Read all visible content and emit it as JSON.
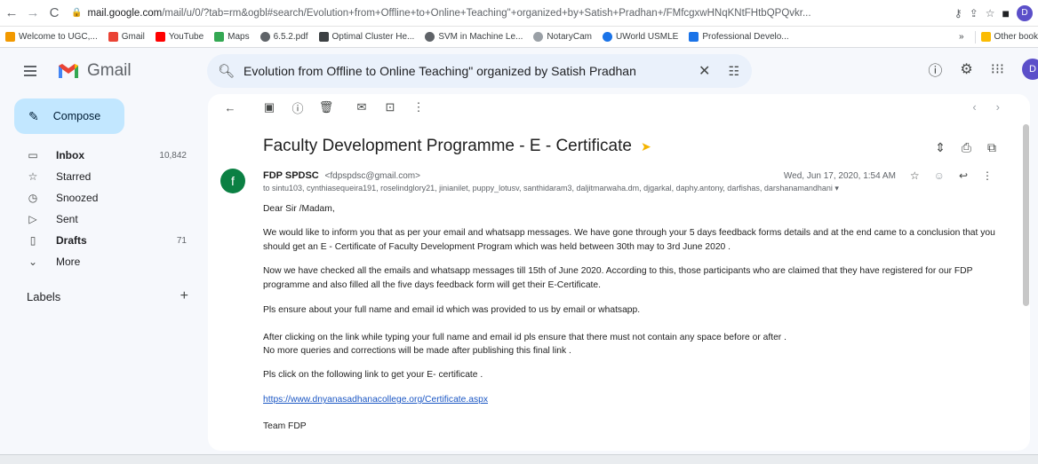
{
  "browser": {
    "url_host": "mail.google.com",
    "url_rest": "/mail/u/0/?tab=rm&ogbl#search/Evolution+from+Offline+to+Online+Teaching\"+organized+by+Satish+Pradhan+/FMfcgxwHNqKNtFHtbQPQvkr...",
    "profile_initial": "D",
    "bookmarks": [
      {
        "label": "Welcome to UGC,...",
        "color": "#f29900"
      },
      {
        "label": "Gmail",
        "color": "#ea4335"
      },
      {
        "label": "YouTube",
        "color": "#ff0000"
      },
      {
        "label": "Maps",
        "color": "#34a853"
      },
      {
        "label": "6.5.2.pdf",
        "color": "#5f6368"
      },
      {
        "label": "Optimal Cluster He...",
        "color": "#3c4043"
      },
      {
        "label": "SVM in Machine Le...",
        "color": "#5f6368"
      },
      {
        "label": "NotaryCam",
        "color": "#9aa0a6"
      },
      {
        "label": "UWorld USMLE",
        "color": "#1a73e8"
      },
      {
        "label": "Professional Develo...",
        "color": "#1a73e8"
      }
    ],
    "bookmarks_more": "»",
    "other_bookmarks": "Other book"
  },
  "gmail": {
    "brand": "Gmail",
    "search_query": "Evolution from Offline to Online Teaching\" organized by Satish Pradhan",
    "avatar_initial": "D"
  },
  "sidebar": {
    "compose_label": "Compose",
    "items": [
      {
        "label": "Inbox",
        "count": "10,842",
        "icon": "inbox-icon",
        "bold": true
      },
      {
        "label": "Starred",
        "count": "",
        "icon": "star-icon",
        "bold": false
      },
      {
        "label": "Snoozed",
        "count": "",
        "icon": "clock-icon",
        "bold": false
      },
      {
        "label": "Sent",
        "count": "",
        "icon": "send-icon",
        "bold": false
      },
      {
        "label": "Drafts",
        "count": "71",
        "icon": "draft-icon",
        "bold": true
      },
      {
        "label": "More",
        "count": "",
        "icon": "chevron-down-icon",
        "bold": false
      }
    ],
    "labels_heading": "Labels"
  },
  "email": {
    "subject": "Faculty Development Programme - E - Certificate",
    "sender_initial": "f",
    "sender_name": "FDP SPDSC",
    "sender_email": "<fdpspdsc@gmail.com>",
    "recipients": "to sintu103, cynthiasequeira191, roselindglory21, jinianilet, puppy_lotusv, santhidaram3, daljitmarwaha.dm, djgarkal, daphy.antony, darfishas, darshanamandhani",
    "date": "Wed, Jun 17, 2020, 1:54 AM",
    "greeting": "Dear Sir /Madam,",
    "para1": "We would like to inform you that as per your email and whatsapp messages. We have gone through your 5 days feedback forms details and at the end came to a conclusion that you should get an E - Certificate of Faculty Development Program which was held between 30th may to 3rd June 2020 .",
    "para2": "Now we have checked all the emails and whatsapp messages till 15th of June 2020. According to this, those participants who are claimed that they have registered for our FDP programme and also filled all the five days feedback form will get their E-Certificate.",
    "para3": "Pls ensure about your full name and email id which was provided to us by email or whatsapp.",
    "para4a": "After clicking on the link while typing your full name and email id pls ensure that there must not contain any space before or after .",
    "para4b": "No more queries and corrections will be made after publishing this final link .",
    "para5": "Pls click on the following link to get your E- certificate .",
    "link": "https://www.dnyanasadhanacollege.org/Certificate.aspx",
    "signoff": "Team FDP"
  }
}
